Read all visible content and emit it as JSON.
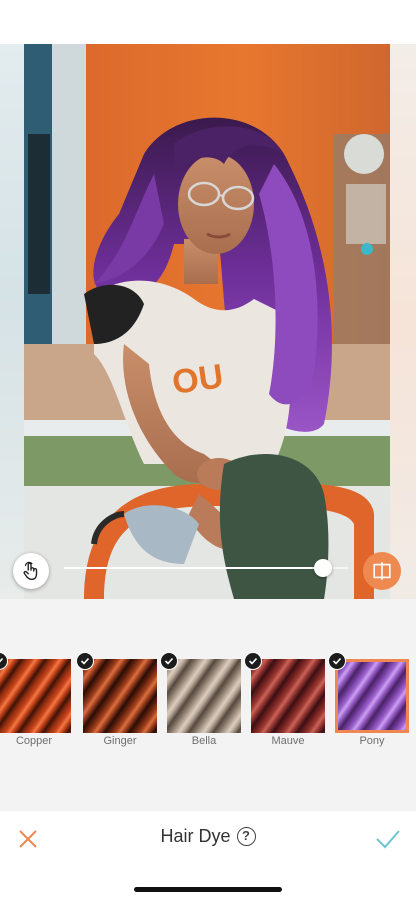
{
  "editor": {
    "tool_title": "Hair Dye",
    "help_glyph": "?",
    "intensity": 0.94,
    "accent_color": "#ef8753",
    "confirm_color": "#6ec3d2"
  },
  "icons": {
    "gesture": "hand-touch-icon",
    "compare": "compare-split-icon",
    "cancel": "close-icon",
    "confirm": "checkmark-icon",
    "help": "question-circle-icon",
    "applied": "check-badge-icon"
  },
  "swatches": [
    {
      "label": "Copper",
      "colors": [
        "#3f1206",
        "#c9441a",
        "#f07a45",
        "#8a2c10"
      ],
      "selected": false
    },
    {
      "label": "Ginger",
      "colors": [
        "#2a0d06",
        "#a3411f",
        "#d9703f",
        "#5e200c"
      ],
      "selected": false
    },
    {
      "label": "Bella",
      "colors": [
        "#55483e",
        "#b9a99a",
        "#dccdbf",
        "#807061"
      ],
      "selected": false
    },
    {
      "label": "Mauve",
      "colors": [
        "#3b0f14",
        "#9c3a33",
        "#c9645a",
        "#6a1e1d"
      ],
      "selected": false
    },
    {
      "label": "Pony",
      "colors": [
        "#4a2266",
        "#9f63d0",
        "#caa2ef",
        "#6d3a96"
      ],
      "selected": true
    }
  ]
}
